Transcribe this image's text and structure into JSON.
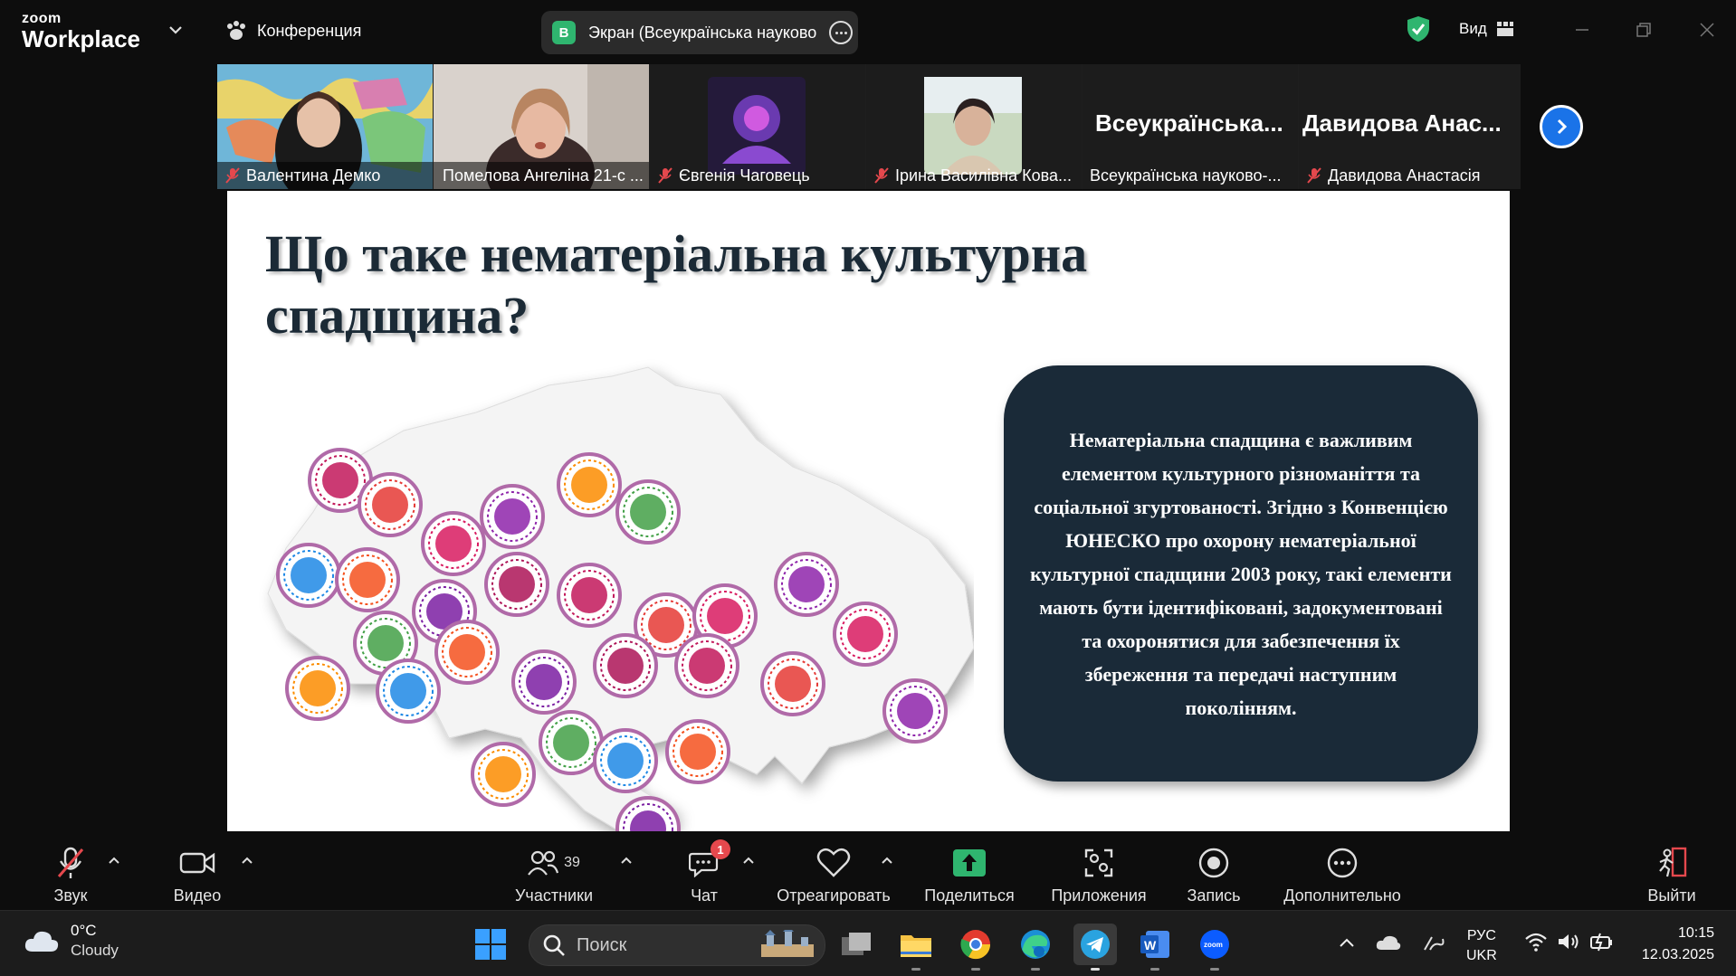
{
  "app": {
    "logo_small": "zoom",
    "logo_big": "Workplace",
    "meeting_label": "Конференция",
    "screen_badge": "В",
    "screen_share_label": "Экран (Всеукраїнська науково",
    "view_label": "Вид"
  },
  "participants": [
    {
      "name": "Валентина Демко",
      "muted": true
    },
    {
      "name": "Помелова Ангеліна 21-с ...",
      "muted": false,
      "active": true
    },
    {
      "name": "Євгенія Чаговець",
      "muted": true
    },
    {
      "name": "Ірина Василівна Кова...",
      "muted": true
    },
    {
      "name": "Всеукраїнська науково-...",
      "big_name": "Всеукраїнська...",
      "muted": false
    },
    {
      "name": "Давидова Анастасія",
      "big_name": "Давидова Анас...",
      "muted": true
    }
  ],
  "slide": {
    "title": "Що таке нематеріальна культурна спадщина?",
    "body": "Нематеріальна спадщина є важливим елементом культурного різноманіття та соціальної згуртованості. Згідно з Конвенцією ЮНЕСКО про охорону нематеріальної культурної спадщини 2003 року, такі елементи мають бути ідентифіковані, задокументовані та охоронятися для забезпечення їх збереження та передачі наступним поколінням.",
    "accent_box": "#1a2a38"
  },
  "toolbar": {
    "audio": "Звук",
    "video": "Видео",
    "participants": "Участники",
    "participants_count": "39",
    "chat": "Чат",
    "chat_badge": "1",
    "react": "Отреагировать",
    "share": "Поделиться",
    "apps": "Приложения",
    "record": "Запись",
    "more": "Дополнительно",
    "leave": "Выйти"
  },
  "taskbar": {
    "temp": "0°C",
    "weather": "Cloudy",
    "search_placeholder": "Поиск",
    "lang1": "РУС",
    "lang2": "UKR",
    "time": "10:15",
    "date": "12.03.2025"
  },
  "colors": {
    "share_green": "#2fb56f",
    "active_tile_border": "#3ddc84",
    "muted_red": "#e5484d",
    "next_blue": "#1a73e8"
  }
}
